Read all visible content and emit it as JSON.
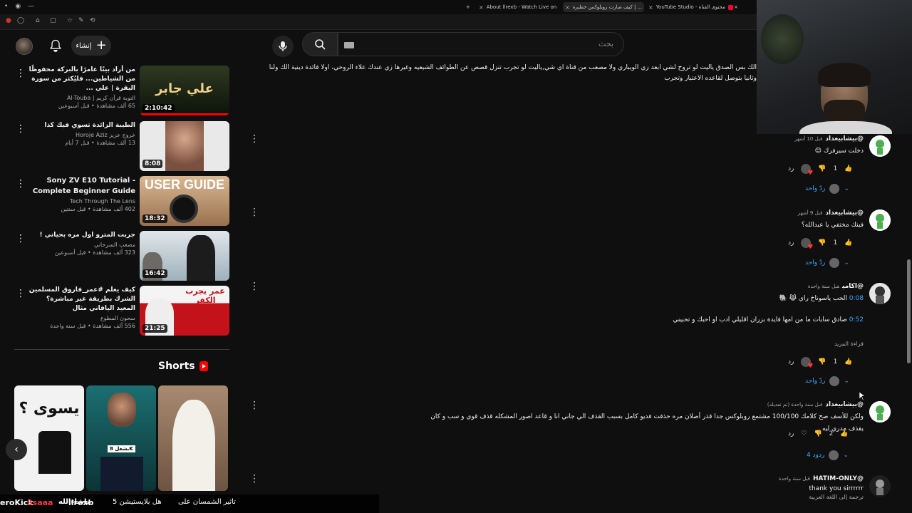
{
  "browser": {
    "tabs": [
      {
        "title": "About llrexb - Watch Live on K",
        "color": "#00e701"
      },
      {
        "title": "كيف صارت روبلوكس خطيرة | ...",
        "color": "#ff0033"
      },
      {
        "title": "YouTube Studio - محتوى القناة",
        "color": "#ff0033"
      }
    ],
    "new_tab": "+"
  },
  "header": {
    "create_label": "إنشاء",
    "search_placeholder": "بحث"
  },
  "related": [
    {
      "title": "من أراد بيتًا عامرًا بالبركة محفوظًا من الشياطين... فليُكثر من سورة البقرة | علي ...",
      "channel": "التوبة قرآن كريم | Al-Touba",
      "views": "65 ألف مشاهدة • قبل أسبوعين",
      "duration": "2:10:42",
      "thumb_text": "علي جابر",
      "thumb_bg": "#1c2a1c"
    },
    {
      "title": "الطيبة الزائدة تسوي فيك كذا",
      "channel": "خروج عزيز Horoje Aziz",
      "views": "13 ألف مشاهدة • قبل 7 أيام",
      "duration": "8:08",
      "thumb_text": "",
      "thumb_bg": "#e9e9e9"
    },
    {
      "title": "Sony ZV E10 Tutorial - Complete Beginner Guide",
      "channel": "Tech Through The Lens",
      "views": "402 ألف مشاهدة • قبل سنتين",
      "duration": "18:32",
      "thumb_text": "USER GUIDE",
      "thumb_bg": "#c9a27c"
    },
    {
      "title": "جربت المترو اول مره بحياتي !",
      "channel": "مصعب السرحاني",
      "views": "323 ألف مشاهدة • قبل أسبوعين",
      "duration": "16:42",
      "thumb_text": "",
      "thumb_bg": "#cfd6da"
    },
    {
      "title": "كيف يعلم #عمر_فاروق المسلمين الشرك بطريقة غير مباشرة؟ المعيد اليافاني مثال",
      "channel": "سحون المطوع",
      "views": "556 ألف مشاهدة • قبل سنة واحدة",
      "duration": "21:25",
      "thumb_text": "عمر يجرب الكفر",
      "thumb_bg": "#b3121a"
    }
  ],
  "shorts": {
    "title": "Shorts",
    "items": [
      {
        "label": "يسوى ؟",
        "bg": "#f2f2f2"
      },
      {
        "label": "بشغل 8K",
        "bg": "#2a9d8f"
      },
      {
        "label": "",
        "bg": "#b7a08a"
      }
    ]
  },
  "top_comment_text": "الك بس الصدق ياليت لو تروح لشي ابعد زي الويباري ولا مصعب من قناة اي شي,ياليت لو تجرب تنزل قصص عن الطوائف الشيعيه وغيرها زي عندك علاء الروحي، اولا فائدة دينية الك ولنا وثانيا بتوصل لقاعده الاعتبار وتجرب",
  "comments": [
    {
      "author": "@بيشابيغداد",
      "when": "قبل 10 أشهر",
      "text": "دخلت سيرفرك 😊",
      "likes": "1",
      "replies": "ردّ واحد",
      "reply_label": "رد"
    },
    {
      "author": "@بيشابيغداد",
      "when": "قبل 9 أشهر",
      "text": "فينك مختفي يا عبدالله؟",
      "likes": "1",
      "replies": "ردّ واحد",
      "reply_label": "رد"
    },
    {
      "author": "@اكامي",
      "when": "قبل سنة واحدة",
      "ts1": "0:08",
      "text1": "الحب ياسوناخ راي 😹 🐘",
      "ts2": "0:52",
      "text2": "صادق سابات ما من امها فايدة بزران اقليلي ادب او احبك و تحبيني",
      "more": "قراءة المزيد",
      "likes": "1",
      "replies": "ردّ واحد",
      "reply_label": "رد"
    },
    {
      "author": "@بيشابيغداد",
      "when": "قبل سنة واحدة (تم تعديله)",
      "text": "ولكن للأسف صح كلامك 100/100 مشتمع روبلوكس جدا قذر أصلان مره حذفت فديو كامل بسبب القذف الي جاني انا و قاعد اصور المشكله قذف قوي و سب و كان يقذف مدري ليه",
      "likes": "2",
      "replies": "4 ردود",
      "reply_label": "رد"
    },
    {
      "author": "@HATIM-ONLY",
      "when": "قبل سنة واحدة",
      "text": "thank you sirrrrrr",
      "translate": "ترجمة إلى اللغة العربية"
    }
  ],
  "ticker": [
    "eroKick",
    "llrexb",
    "ماشاءالله",
    "3saaa",
    "هل بلايستيشن 5",
    "تاثير الشمسان على"
  ]
}
